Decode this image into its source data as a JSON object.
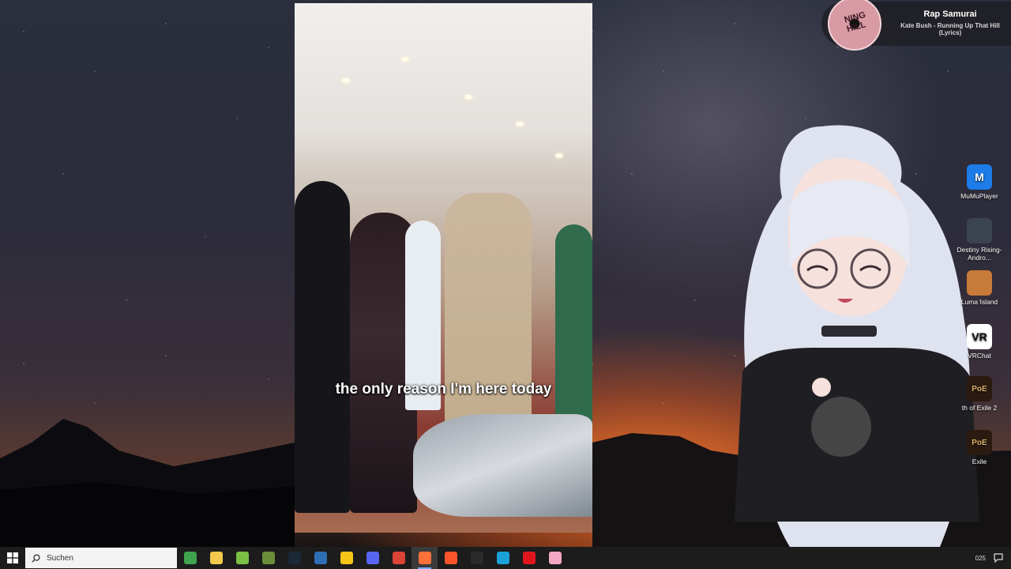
{
  "video": {
    "subtitle": "the only reason I'm here today"
  },
  "now_playing": {
    "title": "Rap Samurai",
    "track": "Kate Bush - Running Up That Hill (Lyrics)",
    "disc_label": "NING HILL"
  },
  "desktop_icons": [
    {
      "label": "MuMuPlayer",
      "icon": "mumu-icon",
      "color": "#1e7ce8",
      "glyph": "M"
    },
    {
      "label": "Destiny Rising-Andro...",
      "icon": "destiny-icon",
      "color": "#3a4450",
      "glyph": ""
    },
    {
      "label": "Luma Island",
      "icon": "luma-island-icon",
      "color": "#c77a3a",
      "glyph": ""
    },
    {
      "label": "VRChat",
      "icon": "vrchat-icon",
      "color": "#ffffff",
      "glyph": "VR"
    },
    {
      "label": "th of Exile 2",
      "icon": "path-of-exile-2-icon",
      "color": "#2a1a10",
      "glyph": "PoE"
    },
    {
      "label": "Exile",
      "icon": "path-of-exile-icon",
      "color": "#2a1a10",
      "glyph": "PoE"
    }
  ],
  "taskbar": {
    "search_label": "Suchen",
    "apps": [
      {
        "name": "calculator-app",
        "color": "#3fa34d"
      },
      {
        "name": "file-explorer-app",
        "color": "#f2c94c"
      },
      {
        "name": "android-app",
        "color": "#7bc043"
      },
      {
        "name": "minecraft-app",
        "color": "#6b8e3a"
      },
      {
        "name": "steam-app",
        "color": "#1b2838"
      },
      {
        "name": "virtualbox-app",
        "color": "#2f6fb5"
      },
      {
        "name": "g-app",
        "color": "#f5c518"
      },
      {
        "name": "discord-app",
        "color": "#5865f2"
      },
      {
        "name": "chrome-app",
        "color": "#db4437"
      },
      {
        "name": "firefox-app",
        "color": "#ff7139"
      },
      {
        "name": "brave-app",
        "color": "#fb542b"
      },
      {
        "name": "obs-app",
        "color": "#2b2b2b"
      },
      {
        "name": "edge-app",
        "color": "#1aa1d8"
      },
      {
        "name": "opera-app",
        "color": "#e0161f"
      },
      {
        "name": "pink-app",
        "color": "#f4a7c5"
      }
    ],
    "active_app_index": 9,
    "clock_year": "025"
  }
}
